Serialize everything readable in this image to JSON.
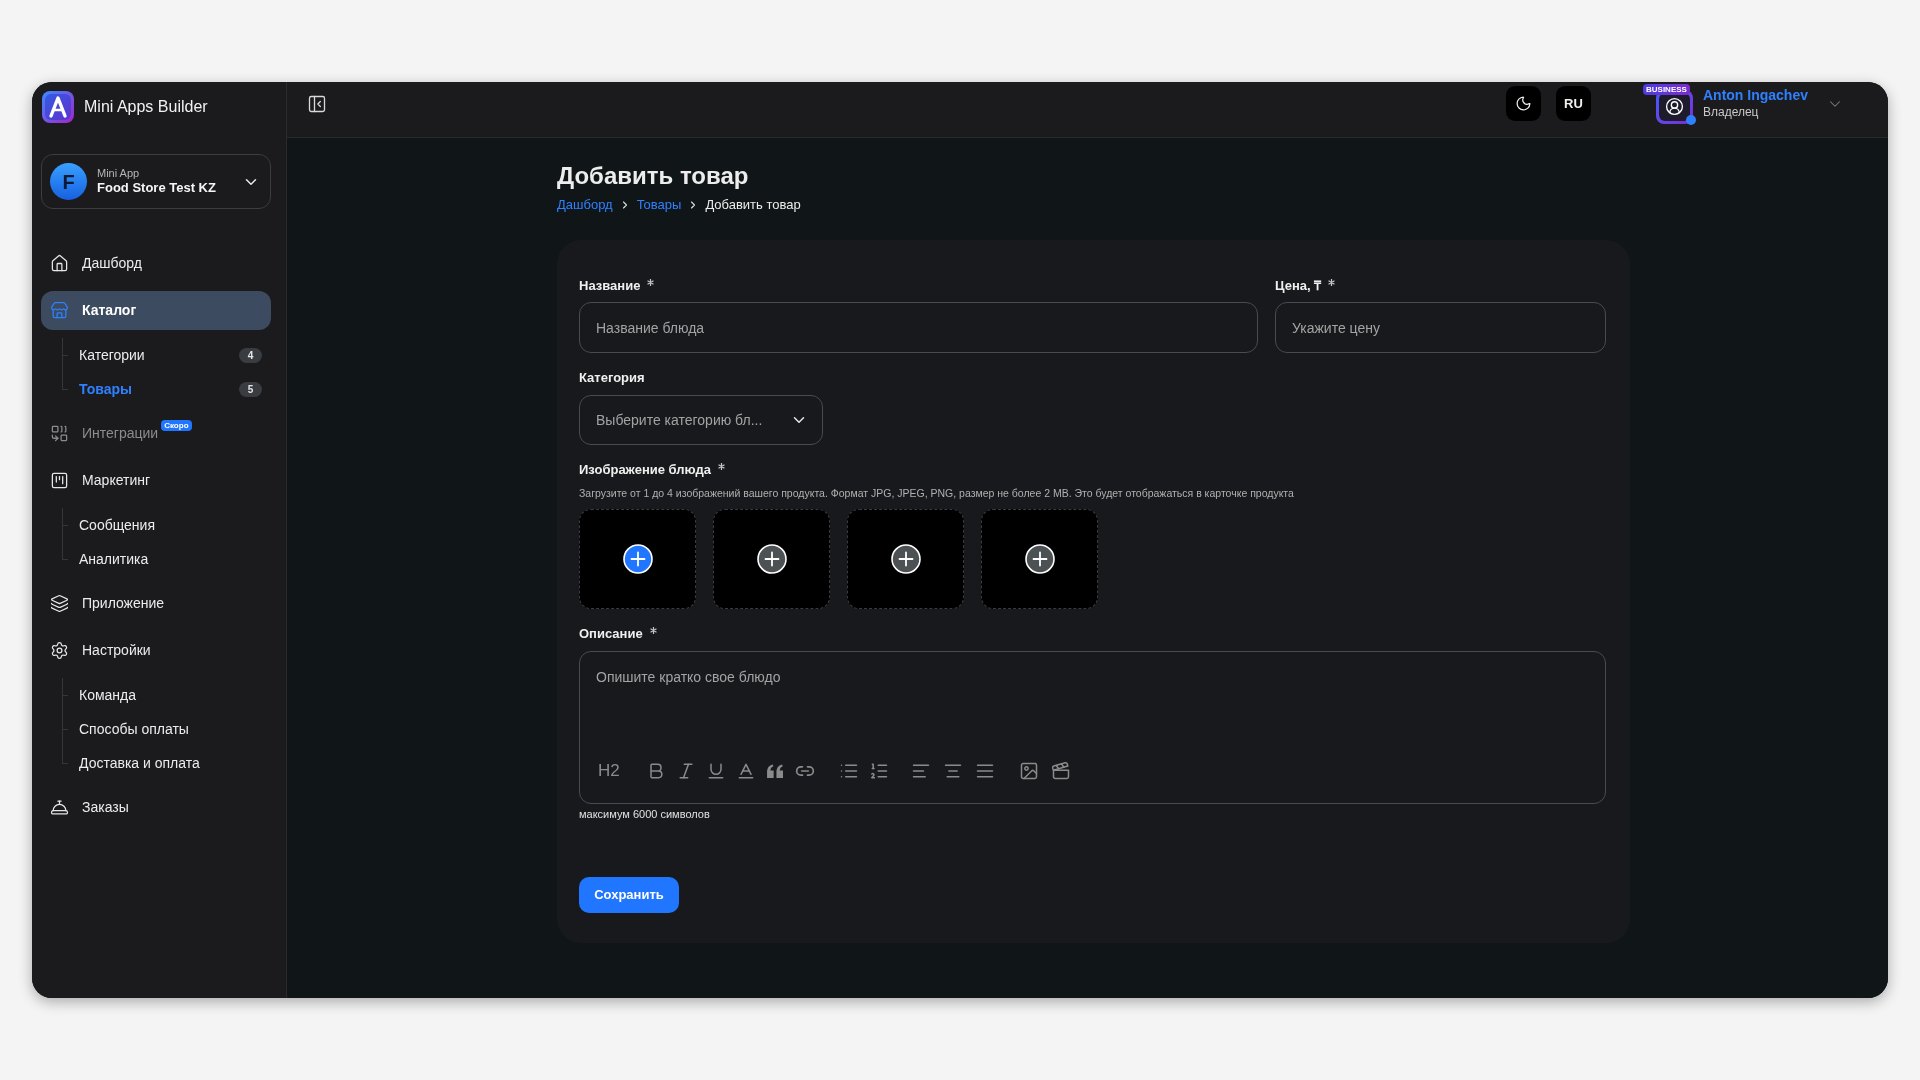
{
  "app": {
    "logo_text": "Mini Apps Builder"
  },
  "sidebar": {
    "app_selector": {
      "avatar_letter": "F",
      "caption": "Mini App",
      "name": "Food Store Test KZ"
    },
    "items": [
      {
        "label": "Дашборд",
        "selected": false,
        "disabled": false
      },
      {
        "label": "Каталог",
        "selected": true,
        "disabled": false,
        "children": [
          {
            "label": "Категории",
            "selected": false,
            "count": "4"
          },
          {
            "label": "Товары",
            "selected": true,
            "count": "5"
          }
        ]
      },
      {
        "label": "Интеграции",
        "selected": false,
        "disabled": true,
        "badge": "Скоро"
      },
      {
        "label": "Маркетинг",
        "selected": false,
        "disabled": false,
        "children": [
          {
            "label": "Сообщения",
            "selected": false
          },
          {
            "label": "Аналитика",
            "selected": false
          }
        ]
      },
      {
        "label": "Приложение",
        "selected": false,
        "disabled": false
      },
      {
        "label": "Настройки",
        "selected": false,
        "disabled": false,
        "children": [
          {
            "label": "Команда",
            "selected": false
          },
          {
            "label": "Способы оплаты",
            "selected": false
          },
          {
            "label": "Доставка и оплата",
            "selected": false
          }
        ]
      },
      {
        "label": "Заказы",
        "selected": false,
        "disabled": false
      }
    ]
  },
  "topbar": {
    "language": "RU",
    "user": {
      "plan_badge": "BUSINESS",
      "name": "Anton Ingachev",
      "role": "Владелец",
      "online": true
    }
  },
  "page": {
    "title": "Добавить товар",
    "breadcrumbs": [
      {
        "label": "Дашборд",
        "link": true
      },
      {
        "label": "Товары",
        "link": true
      },
      {
        "label": "Добавить товар",
        "link": false
      }
    ]
  },
  "form": {
    "name_field": {
      "label": "Название",
      "required": true,
      "placeholder": "Название блюда"
    },
    "price_field": {
      "label": "Цена, ₸",
      "required": true,
      "placeholder": "Укажите цену"
    },
    "category_field": {
      "label": "Категория",
      "required": false,
      "placeholder": "Выберите категорию бл..."
    },
    "images": {
      "label": "Изображение блюда",
      "required": true,
      "hint": "Загрузите от 1 до 4 изображений вашего продукта. Формат JPG, JPEG, PNG, размер не более 2 MB. Это будет отображаться в карточке продукта",
      "slots": [
        {
          "active": true
        },
        {
          "active": false
        },
        {
          "active": false
        },
        {
          "active": false
        }
      ]
    },
    "description": {
      "label": "Описание",
      "required": true,
      "placeholder": "Опишите кратко свое блюдо",
      "heading_button": "H2",
      "note": "максимум 6000 символов"
    },
    "save_button": "Сохранить"
  }
}
